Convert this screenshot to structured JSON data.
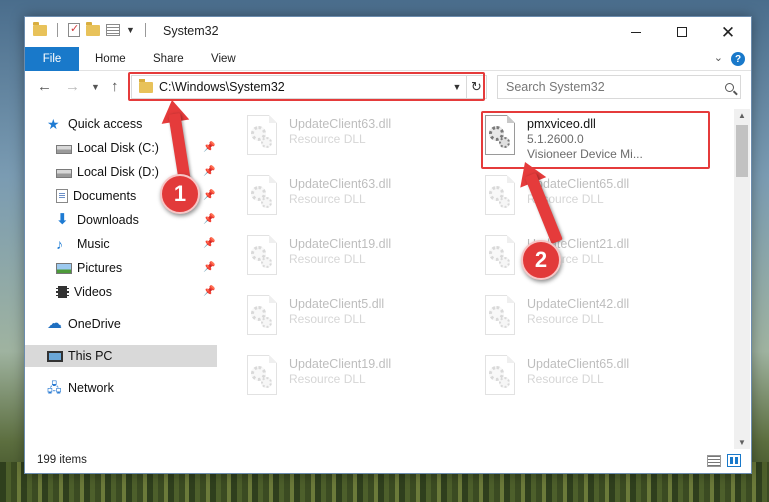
{
  "window": {
    "title": "System32"
  },
  "ribbon": {
    "file_label": "File",
    "home_label": "Home",
    "share_label": "Share",
    "view_label": "View",
    "help_label": "?"
  },
  "address": {
    "path": "C:\\Windows\\System32"
  },
  "search": {
    "placeholder": "Search System32"
  },
  "sidebar": {
    "items": [
      {
        "label": "Quick access",
        "icon": "star-icon",
        "pinned": false
      },
      {
        "label": "Local Disk (C:)",
        "icon": "disk-icon",
        "pinned": true
      },
      {
        "label": "Local Disk (D:)",
        "icon": "disk-icon",
        "pinned": true
      },
      {
        "label": "Documents",
        "icon": "documents-icon",
        "pinned": true
      },
      {
        "label": "Downloads",
        "icon": "downloads-icon",
        "pinned": true
      },
      {
        "label": "Music",
        "icon": "music-icon",
        "pinned": true
      },
      {
        "label": "Pictures",
        "icon": "pictures-icon",
        "pinned": true
      },
      {
        "label": "Videos",
        "icon": "videos-icon",
        "pinned": true
      },
      {
        "label": "OneDrive",
        "icon": "onedrive-icon",
        "pinned": false
      },
      {
        "label": "This PC",
        "icon": "this-pc-icon",
        "pinned": false,
        "selected": true
      },
      {
        "label": "Network",
        "icon": "network-icon",
        "pinned": false
      }
    ]
  },
  "files": [
    {
      "name": "UpdateClient63.dll",
      "sub1": "Resource DLL",
      "sub2": "",
      "faded": true
    },
    {
      "name": "pmxviceo.dll",
      "sub1": "5.1.2600.0",
      "sub2": "Visioneer Device Mi...",
      "faded": false,
      "highlighted": true
    },
    {
      "name": "UpdateClient63.dll",
      "sub1": "Resource DLL",
      "sub2": "",
      "faded": true
    },
    {
      "name": "UpdateClient65.dll",
      "sub1": "Resource DLL",
      "sub2": "",
      "faded": true
    },
    {
      "name": "UpdateClient19.dll",
      "sub1": "Resource DLL",
      "sub2": "",
      "faded": true
    },
    {
      "name": "UpdateClient21.dll",
      "sub1": "Resource DLL",
      "sub2": "",
      "faded": true
    },
    {
      "name": "UpdateClient5.dll",
      "sub1": "Resource DLL",
      "sub2": "",
      "faded": true
    },
    {
      "name": "UpdateClient42.dll",
      "sub1": "Resource DLL",
      "sub2": "",
      "faded": true
    },
    {
      "name": "UpdateClient19.dll",
      "sub1": "Resource DLL",
      "sub2": "",
      "faded": true
    },
    {
      "name": "UpdateClient65.dll",
      "sub1": "Resource DLL",
      "sub2": "",
      "faded": true
    }
  ],
  "status": {
    "item_count": "199 items"
  },
  "annotations": {
    "badge_one": "1",
    "badge_two": "2",
    "color": "#e53b3b"
  },
  "colors": {
    "accent": "#1979ca",
    "selection": "#d9d9d9"
  }
}
